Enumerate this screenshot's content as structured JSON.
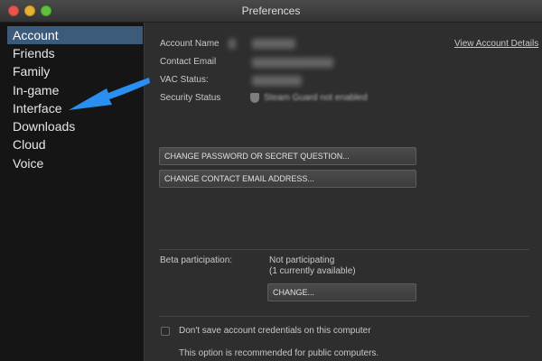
{
  "window": {
    "title": "Preferences"
  },
  "sidebar": {
    "items": [
      {
        "label": "Account",
        "selected": true
      },
      {
        "label": "Friends"
      },
      {
        "label": "Family"
      },
      {
        "label": "In-game"
      },
      {
        "label": "Interface"
      },
      {
        "label": "Downloads"
      },
      {
        "label": "Cloud"
      },
      {
        "label": "Voice"
      }
    ]
  },
  "account": {
    "name_label": "Account Name",
    "email_label": "Contact Email",
    "vac_label": "VAC Status:",
    "security_label": "Security Status",
    "security_value": "Steam Guard not enabled",
    "view_details_link": "View Account Details"
  },
  "buttons": {
    "change_password": "CHANGE PASSWORD OR SECRET QUESTION...",
    "change_email": "CHANGE CONTACT EMAIL ADDRESS...",
    "change_beta": "CHANGE..."
  },
  "beta": {
    "label": "Beta participation:",
    "status": "Not participating",
    "available": "(1 currently available)"
  },
  "credentials": {
    "checkbox_label": "Don't save account credentials on this computer",
    "note": "This option is recommended for public computers."
  },
  "colors": {
    "annotation_arrow": "#2a8ff0",
    "selected_item": "#3c5a7a"
  }
}
